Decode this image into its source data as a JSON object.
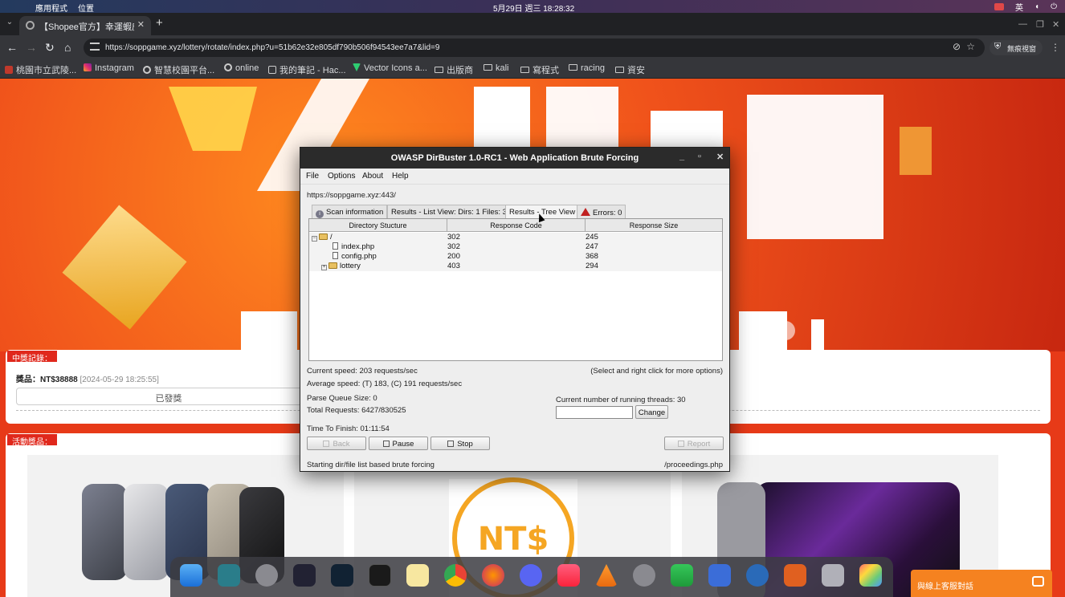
{
  "menubar": {
    "apps_label": "應用程式",
    "places_label": "位置",
    "clock": "5月29日 週三 18:28:32",
    "input_method": "英"
  },
  "browser": {
    "tab_title": "【Shopee官方】幸運蝦皮",
    "url": "https://soppgame.xyz/lottery/rotate/index.php?u=51b62e32e805df790b506f94543ee7a7&lid=9",
    "guest_label": "無痕視窗",
    "bookmarks": [
      {
        "label": "桃園市立武陵...",
        "icon": "red-square",
        "color": "#c0392b"
      },
      {
        "label": "Instagram",
        "icon": "instagram-icon",
        "color": "#e1306c"
      },
      {
        "label": "智慧校園平台...",
        "icon": "globe-icon",
        "color": "#cccccc"
      },
      {
        "label": "online",
        "icon": "globe-icon",
        "color": "#cccccc"
      },
      {
        "label": "我的筆記 - Hac...",
        "icon": "note-icon",
        "color": "#cccccc"
      },
      {
        "label": "Vector Icons a...",
        "icon": "vector-icon",
        "color": "#2ecc71"
      },
      {
        "label": "出版商",
        "icon": "folder-icon",
        "color": "#cccccc"
      },
      {
        "label": "kali",
        "icon": "folder-icon",
        "color": "#cccccc"
      },
      {
        "label": "寫程式",
        "icon": "folder-icon",
        "color": "#cccccc"
      },
      {
        "label": "racing",
        "icon": "folder-icon",
        "color": "#cccccc"
      },
      {
        "label": "資安",
        "icon": "folder-icon",
        "color": "#cccccc"
      }
    ]
  },
  "webpage": {
    "record_tag": "中獎記錄：",
    "prize_label": "獎品：NT$38888",
    "prize_time": "[2024-05-29 18:25:55]",
    "issued_label": "已發獎",
    "activity_tag": "活動獎品：",
    "coin_text": "NT$",
    "chat_label": "與線上客服對話",
    "accent": "#e73a18"
  },
  "dirbuster": {
    "title": "OWASP DirBuster 1.0-RC1 - Web Application Brute Forcing",
    "menu": [
      "File",
      "Options",
      "About",
      "Help"
    ],
    "target": "https://soppgame.xyz:443/",
    "tabs": [
      {
        "label": "Scan information",
        "icon": "info-icon"
      },
      {
        "label": "Results - List View: Dirs: 1 Files: 3",
        "icon": ""
      },
      {
        "label": "Results - Tree View",
        "icon": ""
      },
      {
        "label": "Errors: 0",
        "icon": "warning-icon"
      }
    ],
    "columns": [
      "Directory Stucture",
      "Response Code",
      "Response Size"
    ],
    "rows": [
      {
        "name": "/",
        "code": "302",
        "size": "245"
      },
      {
        "name": "index.php",
        "code": "302",
        "size": "247"
      },
      {
        "name": "config.php",
        "code": "200",
        "size": "368"
      },
      {
        "name": "lottery",
        "code": "403",
        "size": "294"
      }
    ],
    "current_speed": "Current speed: 203 requests/sec",
    "hint": "(Select and right click for more options)",
    "average_speed": "Average speed: (T) 183, (C) 191 requests/sec",
    "parse_queue": "Parse Queue Size: 0",
    "total_requests": "Total Requests: 6427/830525",
    "threads_label": "Current number of running threads: 30",
    "threads_value": "",
    "change_label": "Change",
    "time_to_finish": "Time To Finish: 01:11:54",
    "buttons": {
      "back": "Back",
      "pause": "Pause",
      "stop": "Stop",
      "report": "Report"
    },
    "status_left": "Starting dir/file list based brute forcing",
    "status_right": "/proceedings.php"
  }
}
